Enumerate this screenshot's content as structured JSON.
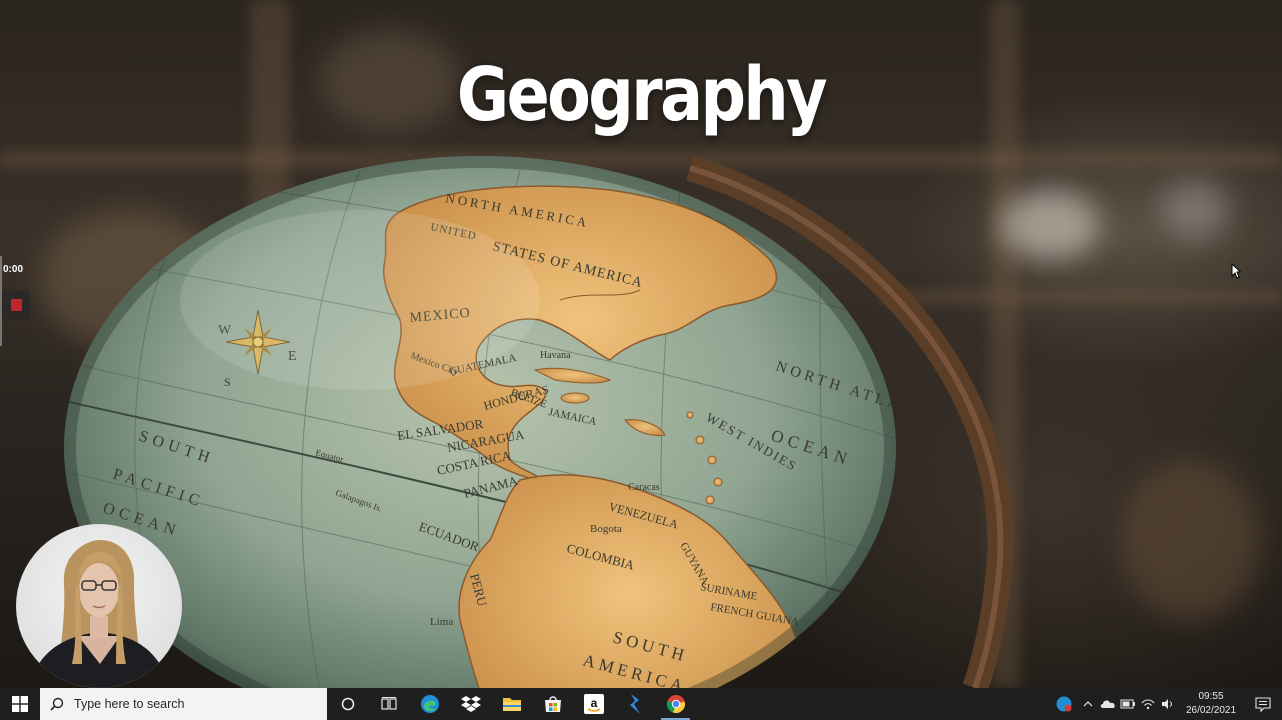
{
  "slide": {
    "title": "Geography"
  },
  "globe_labels": {
    "north_america": "NORTH AMERICA",
    "united_states": "UNITED",
    "states_of_america": "STATES OF AMERICA",
    "mexico": "MEXICO",
    "mexico_city": "Mexico City",
    "guatemala": "GUATEMALA",
    "honduras": "HONDURAS",
    "el_salvador": "EL SALVADOR",
    "nicaragua": "NICARAGUA",
    "costa_rica": "COSTA RICA",
    "panama": "PANAMA",
    "belize": "BELIZE",
    "jamaica": "JAMAICA",
    "havana": "Havana",
    "west_indies": "WEST INDIES",
    "north_atlantic": "NORTH ATLANTIC",
    "ocean": "OCEAN",
    "south_pacific_1": "SOUTH",
    "south_pacific_2": "PACIFIC",
    "south_pacific_3": "OCEAN",
    "venezuela": "VENEZUELA",
    "caracas": "Caracas",
    "bogota": "Bogota",
    "colombia": "COLOMBIA",
    "ecuador": "ECUADOR",
    "peru": "PERU",
    "lima": "Lima",
    "guyana": "GUYANA",
    "suriname": "SURINAME",
    "french_guiana": "FRENCH GUIANA",
    "south_america_1": "SOUTH",
    "south_america_2": "AMERICA",
    "galapagos": "Galapagos Is.",
    "equator": "Equator",
    "compass_w": "W",
    "compass_e": "E",
    "compass_s": "S"
  },
  "media_overlay": {
    "time": "0:00"
  },
  "taskbar": {
    "search_placeholder": "Type here to search",
    "pinned": [
      "cortana-icon",
      "task-view-icon",
      "edge-icon",
      "dropbox-icon",
      "file-explorer-icon",
      "microsoft-store-icon",
      "amazon-icon",
      "power-automate-icon",
      "chrome-icon"
    ],
    "clock_time": "09:55",
    "clock_date": "26/02/2021"
  },
  "colors": {
    "taskbar_bg": "#1f1f1f",
    "search_bg": "#f3f3f3",
    "ocean": "#9fb1a0",
    "land": "#e6b56d",
    "title": "#ffffff"
  }
}
